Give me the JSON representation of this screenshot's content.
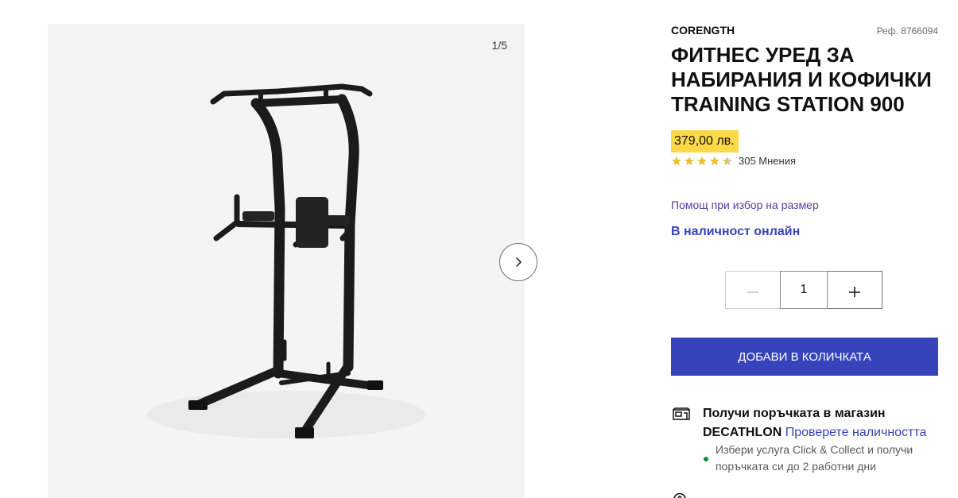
{
  "gallery": {
    "counter": "1/5",
    "next_icon": "chevron-right-icon"
  },
  "product": {
    "brand": "CORENGTH",
    "ref": "Реф. 8766094",
    "title": "ФИТНЕС УРЕД ЗА НАБИРАНИЯ И КОФИЧКИ TRAINING STATION 900",
    "price": "379,00 лв.",
    "rating": 4.5,
    "rating_max": 5,
    "reviews": "305 Мнения",
    "size_help": "Помощ при избор на размер",
    "availability": "В наличност онлайн"
  },
  "quantity": {
    "value": "1",
    "decrease_icon": "minus-icon",
    "increase_icon": "plus-icon",
    "decrease_disabled": true
  },
  "cart": {
    "add_label": "ДОБАВИ В КОЛИЧКАТА"
  },
  "pickup": {
    "icon": "store-icon",
    "title": "Получи поръчката в магазин DECATHLON",
    "link": "Проверете наличността",
    "note": "Избери услуга Click & Collect и получи поръчката си до 2 работни дни"
  },
  "colors": {
    "accent": "#3643ba",
    "price_badge": "#fdd948",
    "link_purple": "#5f3a9c",
    "status_green": "#0b8a44",
    "star": "#e9c23a",
    "star_empty": "#c8c8c8",
    "gallery_bg": "#f5f4f5"
  }
}
